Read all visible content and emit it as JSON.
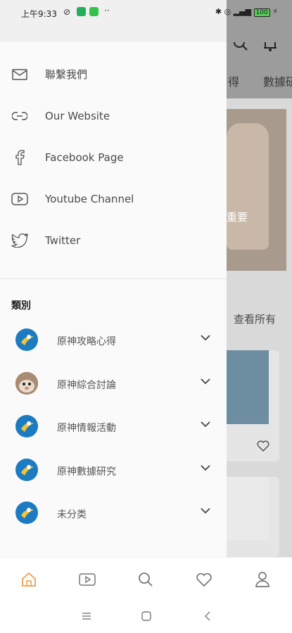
{
  "status_bar": {
    "time": "上午9:33",
    "battery": "100"
  },
  "background": {
    "tabs": [
      "得",
      "數據研"
    ],
    "banner_text": "重要",
    "view_all": "查看所有"
  },
  "drawer": {
    "menu": [
      {
        "label": "聯繫我們",
        "icon": "mail-icon"
      },
      {
        "label": "Our Website",
        "icon": "link-icon"
      },
      {
        "label": "Facebook Page",
        "icon": "facebook-icon"
      },
      {
        "label": "Youtube Channel",
        "icon": "youtube-icon"
      },
      {
        "label": "Twitter",
        "icon": "twitter-icon"
      }
    ],
    "categories_title": "類別",
    "categories": [
      {
        "label": "原神攻略心得"
      },
      {
        "label": "原神綜合討論"
      },
      {
        "label": "原神情報活動"
      },
      {
        "label": "原神數據研究"
      },
      {
        "label": "未分类"
      }
    ]
  },
  "bottom_nav": {
    "items": [
      "home-icon",
      "video-icon",
      "search-icon",
      "heart-icon",
      "profile-icon"
    ],
    "active_color": "#f0a04b"
  },
  "system_nav": [
    "menu-icon",
    "home-square-icon",
    "back-icon"
  ],
  "colors": {
    "category_avatar": "#1d7bc2",
    "active_nav": "#f0a04b",
    "overlay": "#9c9c9c"
  }
}
